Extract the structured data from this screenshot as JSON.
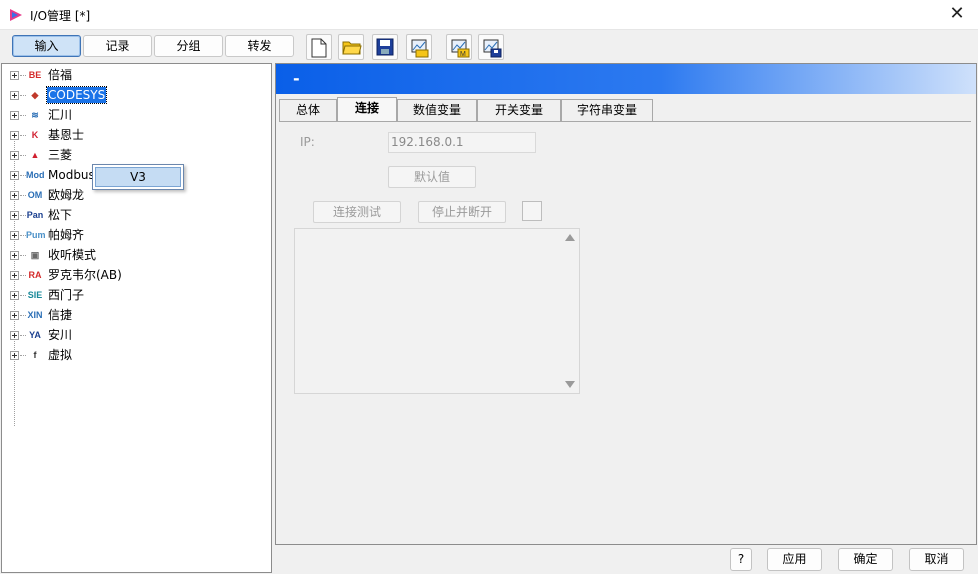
{
  "window": {
    "title": "I/O管理 [*]",
    "close_glyph": "✕"
  },
  "toolbar": {
    "buttons": [
      "输入",
      "记录",
      "分组",
      "转发"
    ],
    "active_index": 0,
    "icon_buttons": [
      "new-file-icon",
      "open-folder-icon",
      "save-icon",
      "import-icon",
      "export-m-icon",
      "export-lock-icon"
    ]
  },
  "tree": {
    "items": [
      {
        "label": "倍福",
        "icon_text": "BE",
        "icon_color": "#d42a2a"
      },
      {
        "label": "CODESYS",
        "icon_text": "◆",
        "icon_color": "#c0392b",
        "selected": true
      },
      {
        "label": "汇川",
        "icon_text": "≋",
        "icon_color": "#2b6fb6"
      },
      {
        "label": "基恩士",
        "icon_text": "K",
        "icon_color": "#d01f2f"
      },
      {
        "label": "三菱",
        "icon_text": "▲",
        "icon_color": "#d01f2f"
      },
      {
        "label": "Modbus TCP",
        "icon_text": "Mod",
        "icon_color": "#2b6fb6"
      },
      {
        "label": "欧姆龙",
        "icon_text": "OM",
        "icon_color": "#2b6fb6"
      },
      {
        "label": "松下",
        "icon_text": "Pan",
        "icon_color": "#1a3f8f"
      },
      {
        "label": "帕姆齐",
        "icon_text": "Pum",
        "icon_color": "#4a90c8"
      },
      {
        "label": "收听模式",
        "icon_text": "▣",
        "icon_color": "#6a6a6a"
      },
      {
        "label": "罗克韦尔(AB)",
        "icon_text": "RA",
        "icon_color": "#d42a2a"
      },
      {
        "label": "西门子",
        "icon_text": "SIE",
        "icon_color": "#1a8a9a"
      },
      {
        "label": "信捷",
        "icon_text": "XIN",
        "icon_color": "#2b6fb6"
      },
      {
        "label": "安川",
        "icon_text": "YA",
        "icon_color": "#1a3f8f"
      },
      {
        "label": "虚拟",
        "icon_text": "f",
        "icon_color": "#333333"
      }
    ],
    "popup_item": "V3"
  },
  "panel": {
    "banner_text": "-",
    "tabs": [
      "总体",
      "连接",
      "数值变量",
      "开关变量",
      "字符串变量"
    ],
    "active_tab": 1,
    "ip_label": "IP:",
    "ip_value": "192.168.0.1",
    "default_button": "默认值",
    "test_button": "连接测试",
    "stop_button": "停止并断开"
  },
  "footer": {
    "help": "?",
    "apply": "应用",
    "ok": "确定",
    "cancel": "取消"
  }
}
